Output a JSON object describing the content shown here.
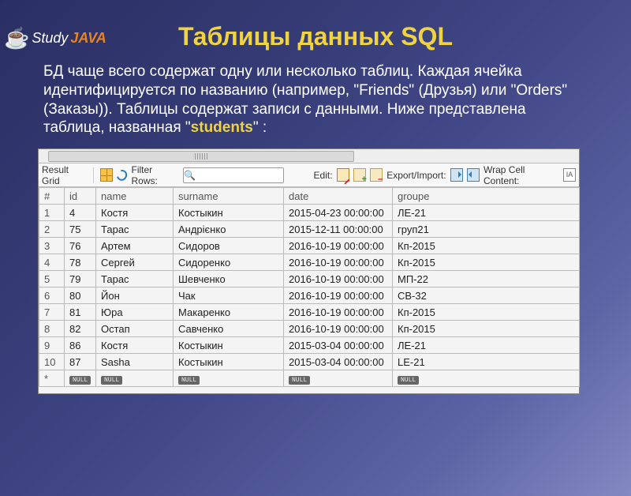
{
  "logo": {
    "study": "Study",
    "java": "JAVA"
  },
  "title": "Таблицы данных SQL",
  "desc": {
    "text_before": "БД чаще всего содержат одну или несколько таблиц. Каждая ячейка идентифицируется по названию (например, \"Friends\" (Друзья) или \"Orders\" (Заказы)). Таблицы содержат записи с данными. Ниже представлена таблица, названная \"",
    "highlight": "students",
    "text_after": "\" :"
  },
  "toolbar": {
    "result_grid": "Result Grid",
    "filter_rows": "Filter Rows:",
    "filter_value": "",
    "edit": "Edit:",
    "export_import": "Export/Import:",
    "wrap_cell": "Wrap Cell Content:"
  },
  "table": {
    "headers": [
      "#",
      "id",
      "name",
      "surname",
      "date",
      "groupe"
    ],
    "rows": [
      {
        "n": "1",
        "id": "4",
        "name": "Костя",
        "surname": "Костыкин",
        "date": "2015-04-23 00:00:00",
        "groupe": "ЛЕ-21"
      },
      {
        "n": "2",
        "id": "75",
        "name": "Тарас",
        "surname": "Андрієнко",
        "date": "2015-12-11 00:00:00",
        "groupe": "груп21"
      },
      {
        "n": "3",
        "id": "76",
        "name": "Артем",
        "surname": "Сидоров",
        "date": "2016-10-19 00:00:00",
        "groupe": "Кп-2015"
      },
      {
        "n": "4",
        "id": "78",
        "name": "Сергей",
        "surname": "Сидоренко",
        "date": "2016-10-19 00:00:00",
        "groupe": "Кп-2015"
      },
      {
        "n": "5",
        "id": "79",
        "name": "Тарас",
        "surname": "Шевченко",
        "date": "2016-10-19 00:00:00",
        "groupe": "МП-22"
      },
      {
        "n": "6",
        "id": "80",
        "name": "Йон",
        "surname": "Чак",
        "date": "2016-10-19 00:00:00",
        "groupe": "СВ-32"
      },
      {
        "n": "7",
        "id": "81",
        "name": "Юра",
        "surname": "Макаренко",
        "date": "2016-10-19 00:00:00",
        "groupe": "Кп-2015"
      },
      {
        "n": "8",
        "id": "82",
        "name": "Остап",
        "surname": "Савченко",
        "date": "2016-10-19 00:00:00",
        "groupe": "Кп-2015"
      },
      {
        "n": "9",
        "id": "86",
        "name": "Костя",
        "surname": "Костыкин",
        "date": "2015-03-04 00:00:00",
        "groupe": "ЛЕ-21"
      },
      {
        "n": "10",
        "id": "87",
        "name": "Sasha",
        "surname": "Костыкин",
        "date": "2015-03-04 00:00:00",
        "groupe": "LE-21"
      }
    ],
    "null_label": "NULL",
    "new_row_marker": "*"
  }
}
